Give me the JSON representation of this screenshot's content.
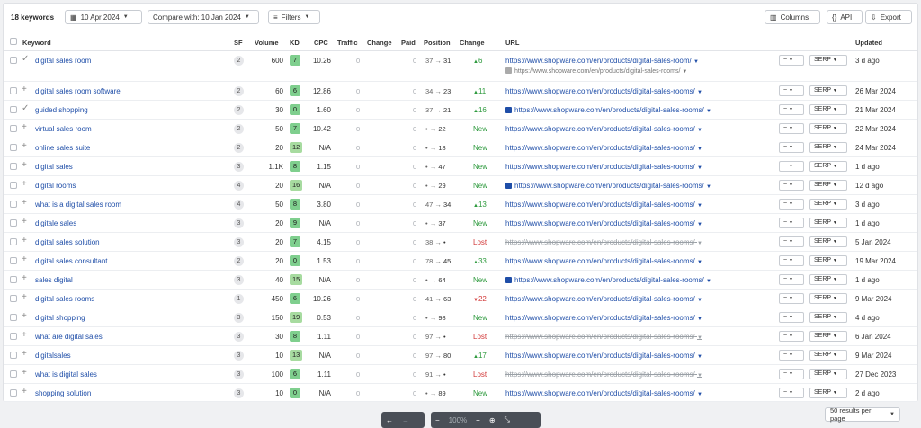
{
  "toolbar": {
    "count": "18 keywords",
    "date": "10 Apr 2024",
    "compare": "Compare with: 10 Jan 2024",
    "filters": "Filters",
    "columns": "Columns",
    "api": "API",
    "export": "Export"
  },
  "headers": [
    "Keyword",
    "SF",
    "Volume",
    "KD",
    "CPC",
    "Traffic",
    "Change",
    "Paid",
    "Position",
    "Change",
    "URL",
    "Updated"
  ],
  "colors": {
    "kd_green": "#7fcf8e",
    "kd_light": "#a7dba0",
    "link": "#1f4ea8",
    "up": "#2e9a3e",
    "down": "#d23a3a"
  },
  "rows": [
    {
      "mark": "check",
      "keyword": "digital sales room",
      "sf": "2",
      "volume": "600",
      "kd": "7",
      "cpc": "10.26",
      "traffic": "0",
      "paid": "0",
      "pos_from": "37",
      "pos_to": "31",
      "change": "6",
      "change_type": "up",
      "url": "https://www.shopware.com/en/products/digital-sales-room/",
      "url_icon": false,
      "url2": "https://www.shopware.com/en/products/digital-sales-rooms/",
      "btn_trend": "~",
      "btn_serp": "SERP",
      "updated": "3 d ago"
    },
    {
      "mark": "plus",
      "keyword": "digital sales room software",
      "sf": "2",
      "volume": "60",
      "kd": "6",
      "cpc": "12.86",
      "traffic": "0",
      "paid": "0",
      "pos_from": "34",
      "pos_to": "23",
      "change": "11",
      "change_type": "up",
      "url": "https://www.shopware.com/en/products/digital-sales-rooms/",
      "url_icon": false,
      "url2": "",
      "btn_trend": "~",
      "btn_serp": "SERP",
      "updated": "26 Mar 2024"
    },
    {
      "mark": "check",
      "keyword": "guided shopping",
      "sf": "2",
      "volume": "30",
      "kd": "0",
      "cpc": "1.60",
      "traffic": "0",
      "paid": "0",
      "pos_from": "37",
      "pos_to": "21",
      "change": "16",
      "change_type": "up",
      "url": "https://www.shopware.com/en/products/digital-sales-rooms/",
      "url_icon": true,
      "url2": "",
      "btn_trend": "~",
      "btn_serp": "SERP",
      "updated": "21 Mar 2024"
    },
    {
      "mark": "plus",
      "keyword": "virtual sales room",
      "sf": "2",
      "volume": "50",
      "kd": "7",
      "cpc": "10.42",
      "traffic": "0",
      "paid": "0",
      "pos_from": "•",
      "pos_to": "22",
      "change": "New",
      "change_type": "new",
      "url": "https://www.shopware.com/en/products/digital-sales-rooms/",
      "url_icon": false,
      "url2": "",
      "btn_trend": "~",
      "btn_serp": "SERP",
      "updated": "22 Mar 2024"
    },
    {
      "mark": "plus",
      "keyword": "online sales suite",
      "sf": "2",
      "volume": "20",
      "kd": "12",
      "cpc": "N/A",
      "traffic": "0",
      "paid": "0",
      "pos_from": "•",
      "pos_to": "18",
      "change": "New",
      "change_type": "new",
      "url": "https://www.shopware.com/en/products/digital-sales-rooms/",
      "url_icon": false,
      "url2": "",
      "btn_trend": "~",
      "btn_serp": "SERP",
      "updated": "24 Mar 2024"
    },
    {
      "mark": "plus",
      "keyword": "digital sales",
      "sf": "3",
      "volume": "1.1K",
      "kd": "8",
      "cpc": "1.15",
      "traffic": "0",
      "paid": "0",
      "pos_from": "•",
      "pos_to": "47",
      "change": "New",
      "change_type": "new",
      "url": "https://www.shopware.com/en/products/digital-sales-rooms/",
      "url_icon": false,
      "url2": "",
      "btn_trend": "~",
      "btn_serp": "SERP",
      "updated": "1 d ago"
    },
    {
      "mark": "plus",
      "keyword": "digital rooms",
      "sf": "4",
      "volume": "20",
      "kd": "16",
      "cpc": "N/A",
      "traffic": "0",
      "paid": "0",
      "pos_from": "•",
      "pos_to": "29",
      "change": "New",
      "change_type": "new",
      "url": "https://www.shopware.com/en/products/digital-sales-rooms/",
      "url_icon": true,
      "url2": "",
      "btn_trend": "~",
      "btn_serp": "SERP",
      "updated": "12 d ago"
    },
    {
      "mark": "plus",
      "keyword": "what is a digital sales room",
      "sf": "4",
      "volume": "50",
      "kd": "8",
      "cpc": "3.80",
      "traffic": "0",
      "paid": "0",
      "pos_from": "47",
      "pos_to": "34",
      "change": "13",
      "change_type": "up",
      "url": "https://www.shopware.com/en/products/digital-sales-rooms/",
      "url_icon": false,
      "url2": "",
      "btn_trend": "~",
      "btn_serp": "SERP",
      "updated": "3 d ago"
    },
    {
      "mark": "plus",
      "keyword": "digitale sales",
      "sf": "3",
      "volume": "20",
      "kd": "9",
      "cpc": "N/A",
      "traffic": "0",
      "paid": "0",
      "pos_from": "•",
      "pos_to": "37",
      "change": "New",
      "change_type": "new",
      "url": "https://www.shopware.com/en/products/digital-sales-rooms/",
      "url_icon": false,
      "url2": "",
      "btn_trend": "~",
      "btn_serp": "SERP",
      "updated": "1 d ago"
    },
    {
      "mark": "plus",
      "keyword": "digital sales solution",
      "sf": "3",
      "volume": "20",
      "kd": "7",
      "cpc": "4.15",
      "traffic": "0",
      "paid": "0",
      "pos_from": "38",
      "pos_to": "•",
      "change": "Lost",
      "change_type": "lost",
      "url": "https://www.shopware.com/en/products/digital-sales-rooms/",
      "url_icon": false,
      "url2": "",
      "btn_trend": "~",
      "btn_serp": "SERP",
      "updated": "5 Jan 2024"
    },
    {
      "mark": "plus",
      "keyword": "digital sales consultant",
      "sf": "2",
      "volume": "20",
      "kd": "0",
      "cpc": "1.53",
      "traffic": "0",
      "paid": "0",
      "pos_from": "78",
      "pos_to": "45",
      "change": "33",
      "change_type": "up",
      "url": "https://www.shopware.com/en/products/digital-sales-rooms/",
      "url_icon": false,
      "url2": "",
      "btn_trend": "~",
      "btn_serp": "SERP",
      "updated": "19 Mar 2024"
    },
    {
      "mark": "plus",
      "keyword": "sales digital",
      "sf": "3",
      "volume": "40",
      "kd": "15",
      "cpc": "N/A",
      "traffic": "0",
      "paid": "0",
      "pos_from": "•",
      "pos_to": "64",
      "change": "New",
      "change_type": "new",
      "url": "https://www.shopware.com/en/products/digital-sales-rooms/",
      "url_icon": true,
      "url2": "",
      "btn_trend": "~",
      "btn_serp": "SERP",
      "updated": "1 d ago"
    },
    {
      "mark": "plus",
      "keyword": "digital sales rooms",
      "sf": "1",
      "volume": "450",
      "kd": "6",
      "cpc": "10.26",
      "traffic": "0",
      "paid": "0",
      "pos_from": "41",
      "pos_to": "63",
      "change": "22",
      "change_type": "down",
      "url": "https://www.shopware.com/en/products/digital-sales-rooms/",
      "url_icon": false,
      "url2": "",
      "btn_trend": "~",
      "btn_serp": "SERP",
      "updated": "9 Mar 2024"
    },
    {
      "mark": "plus",
      "keyword": "digital shopping",
      "sf": "3",
      "volume": "150",
      "kd": "19",
      "cpc": "0.53",
      "traffic": "0",
      "paid": "0",
      "pos_from": "•",
      "pos_to": "98",
      "change": "New",
      "change_type": "new",
      "url": "https://www.shopware.com/en/products/digital-sales-rooms/",
      "url_icon": false,
      "url2": "",
      "btn_trend": "~",
      "btn_serp": "SERP",
      "updated": "4 d ago"
    },
    {
      "mark": "plus",
      "keyword": "what are digital sales",
      "sf": "3",
      "volume": "30",
      "kd": "8",
      "cpc": "1.11",
      "traffic": "0",
      "paid": "0",
      "pos_from": "97",
      "pos_to": "•",
      "change": "Lost",
      "change_type": "lost",
      "url": "https://www.shopware.com/en/products/digital-sales-rooms/",
      "url_icon": false,
      "url2": "",
      "btn_trend": "~",
      "btn_serp": "SERP",
      "updated": "6 Jan 2024"
    },
    {
      "mark": "plus",
      "keyword": "digitalsales",
      "sf": "3",
      "volume": "10",
      "kd": "13",
      "cpc": "N/A",
      "traffic": "0",
      "paid": "0",
      "pos_from": "97",
      "pos_to": "80",
      "change": "17",
      "change_type": "up",
      "url": "https://www.shopware.com/en/products/digital-sales-rooms/",
      "url_icon": false,
      "url2": "",
      "btn_trend": "~",
      "btn_serp": "SERP",
      "updated": "9 Mar 2024"
    },
    {
      "mark": "plus",
      "keyword": "what is digital sales",
      "sf": "3",
      "volume": "100",
      "kd": "6",
      "cpc": "1.11",
      "traffic": "0",
      "paid": "0",
      "pos_from": "91",
      "pos_to": "•",
      "change": "Lost",
      "change_type": "lost",
      "url": "https://www.shopware.com/en/products/digital-sales-rooms/",
      "url_icon": false,
      "url2": "",
      "btn_trend": "~",
      "btn_serp": "SERP",
      "updated": "27 Dec 2023"
    },
    {
      "mark": "plus",
      "keyword": "shopping solution",
      "sf": "3",
      "volume": "10",
      "kd": "0",
      "cpc": "N/A",
      "traffic": "0",
      "paid": "0",
      "pos_from": "•",
      "pos_to": "89",
      "change": "New",
      "change_type": "new",
      "url": "https://www.shopware.com/en/products/digital-sales-rooms/",
      "url_icon": false,
      "url2": "",
      "btn_trend": "~",
      "btn_serp": "SERP",
      "updated": "2 d ago"
    }
  ],
  "pager": {
    "prev": "←",
    "next": "→",
    "zoom_out": "−",
    "zoom": "100%",
    "zoom_in": "+",
    "download": "⊕",
    "collapse": "⤡"
  },
  "per_page": "50 results per page"
}
